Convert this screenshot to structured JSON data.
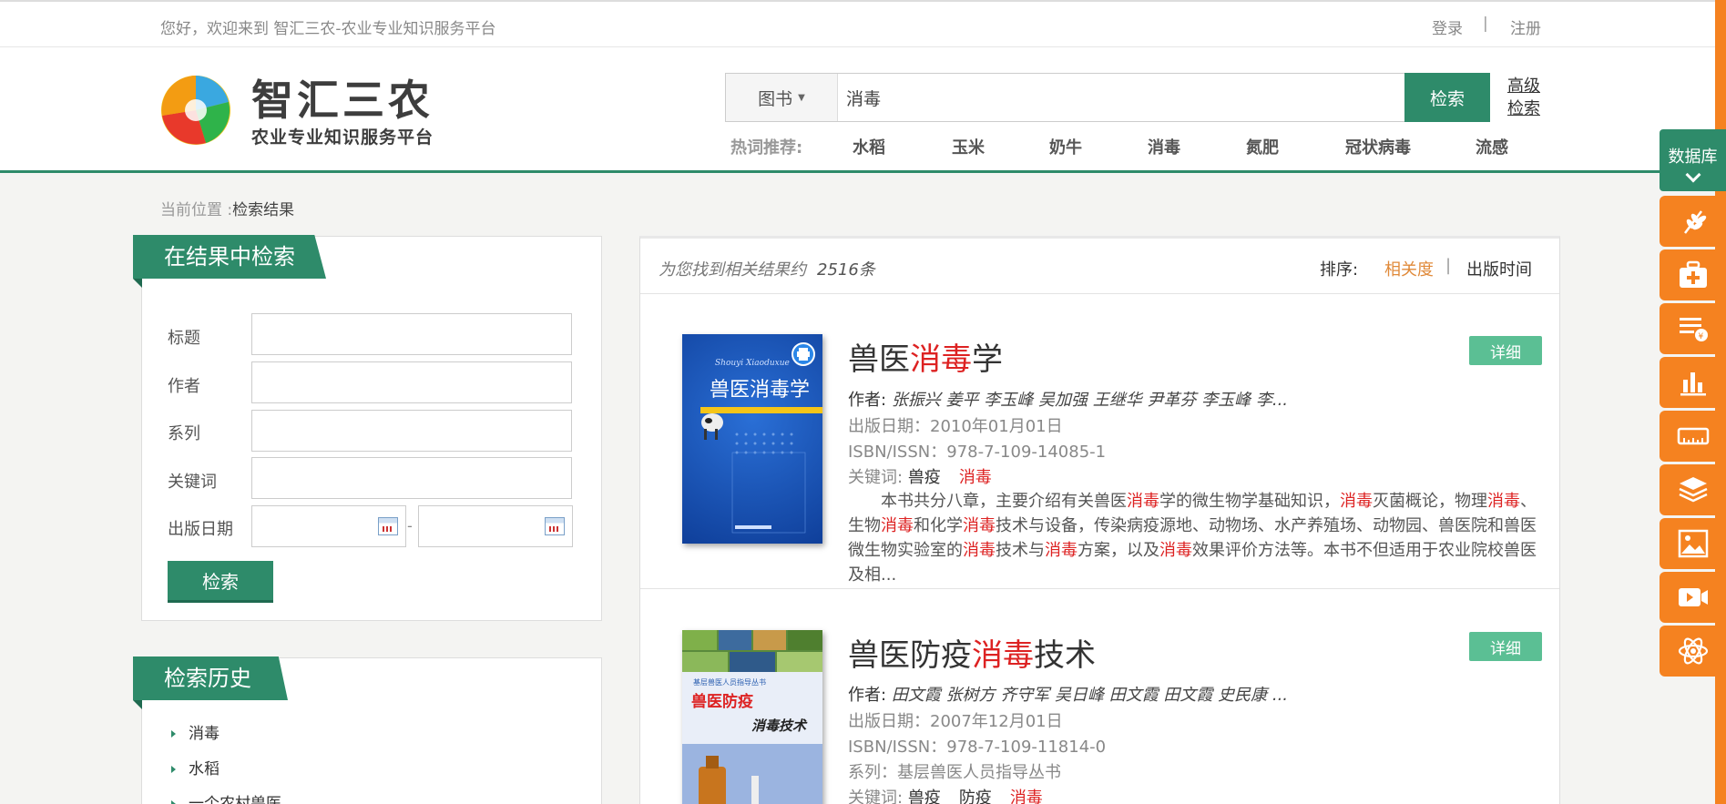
{
  "topbar": {
    "welcome": "您好，欢迎来到 智汇三农-农业专业知识服务平台",
    "login": "登录",
    "separator": "|",
    "register": "注册"
  },
  "logo": {
    "title": "智汇三农",
    "subtitle": "农业专业知识服务平台"
  },
  "search": {
    "type_label": "图书",
    "query": "消毒",
    "button": "检索",
    "advanced_line1": "高级",
    "advanced_line2": "检索"
  },
  "hot": {
    "label": "热词推荐:",
    "items": [
      "水稻",
      "玉米",
      "奶牛",
      "消毒",
      "氮肥",
      "冠状病毒",
      "流感"
    ]
  },
  "breadcrumb": {
    "prefix": "当前位置 :",
    "current": "检索结果"
  },
  "refine": {
    "title": "在结果中检索",
    "fields": [
      "标题",
      "作者",
      "系列",
      "关键词",
      "出版日期"
    ],
    "date_separator": "-",
    "button": "检索"
  },
  "history": {
    "title": "检索历史",
    "items": [
      "消毒",
      "水稻",
      "一个农村兽医"
    ]
  },
  "results": {
    "count_prefix": "为您找到相关结果约",
    "count": "2516条",
    "sort_label": "排序:",
    "sort_relevance": "相关度",
    "sort_sep": "|",
    "sort_date": "出版时间",
    "detail_label": "详细",
    "books": [
      {
        "title_pre": "兽医",
        "title_hl": "消毒",
        "title_post": "学",
        "author_label": "作者:",
        "authors": "张振兴  姜平  李玉峰  吴加强  王继华  尹革芬  李玉峰  李...",
        "date": "出版日期：2010年01月01日",
        "isbn": "ISBN/ISSN：978-7-109-14085-1",
        "kw_label": "关键词:",
        "keywords": [
          "兽疫",
          "消毒"
        ],
        "desc": "本书共分八章，主要介绍有关兽医消毒学的微生物学基础知识，消毒灭菌概论，物理消毒、生物消毒和化学消毒技术与设备，传染病疫源地、动物场、水产养殖场、动物园、兽医院和兽医微生物实验室的消毒技术与消毒方案，以及消毒效果评价方法等。本书不但适用于农业院校兽医及相..."
      },
      {
        "title_pre": "兽医防疫",
        "title_hl": "消毒",
        "title_post": "技术",
        "author_label": "作者:",
        "authors": "田文霞  张树方  齐守军  吴日峰  田文霞  田文霞  史民康  ...",
        "date": "出版日期：2007年12月01日",
        "isbn": "ISBN/ISSN：978-7-109-11814-0",
        "series": "系列：基层兽医人员指导丛书",
        "kw_label": "关键词:",
        "keywords": [
          "兽疫",
          "防疫",
          "消毒"
        ]
      }
    ]
  },
  "sidebar": {
    "database_label": "数据库",
    "icons": [
      "wheat-icon",
      "medical-kit-icon",
      "finance-list-icon",
      "bar-chart-icon",
      "ruler-icon",
      "layers-icon",
      "image-icon",
      "video-icon",
      "atom-icon"
    ]
  },
  "colors": {
    "brand_green": "#2e8b6a",
    "highlight_red": "#d22222",
    "accent_orange": "#f58220",
    "detail_green": "#5bbf94"
  }
}
